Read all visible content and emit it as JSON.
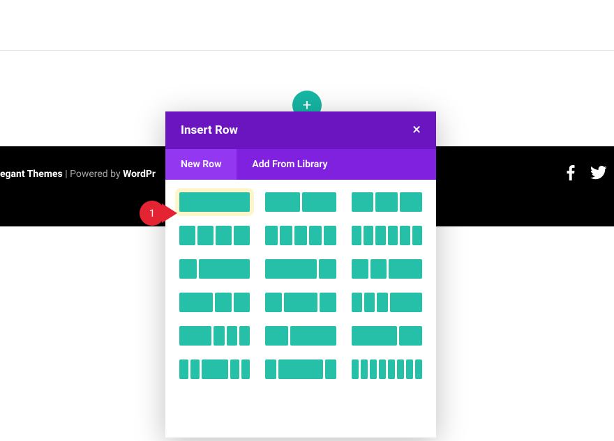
{
  "footer": {
    "brand": "egant Themes",
    "separator": " | ",
    "poweredBy": "Powered by ",
    "platform": "WordPr"
  },
  "addButton": {
    "label": "+"
  },
  "modal": {
    "title": "Insert Row",
    "close": "×",
    "tabs": [
      {
        "label": "New Row",
        "active": true
      },
      {
        "label": "Add From Library",
        "active": false
      }
    ]
  },
  "callout": {
    "number": "1"
  },
  "layouts": [
    {
      "cols": [
        1
      ],
      "selected": true
    },
    {
      "cols": [
        1,
        1
      ]
    },
    {
      "cols": [
        1,
        1,
        1
      ]
    },
    {
      "cols": [
        1,
        1,
        1,
        1
      ]
    },
    {
      "cols": [
        1,
        1,
        1,
        1,
        1
      ]
    },
    {
      "cols": [
        1,
        1,
        1,
        1,
        1,
        1
      ]
    },
    {
      "cols": [
        1,
        3
      ]
    },
    {
      "cols": [
        3,
        1
      ]
    },
    {
      "cols": [
        1,
        1,
        2
      ]
    },
    {
      "cols": [
        2,
        1,
        1
      ]
    },
    {
      "cols": [
        1,
        2,
        1
      ]
    },
    {
      "cols": [
        1,
        1,
        1,
        3
      ]
    },
    {
      "cols": [
        3,
        1,
        1,
        1
      ]
    },
    {
      "cols": [
        1,
        2
      ]
    },
    {
      "cols": [
        2,
        1
      ]
    },
    {
      "cols": [
        1,
        1,
        3,
        1,
        1
      ]
    },
    {
      "cols": [
        1,
        4,
        1
      ]
    },
    {
      "cols": [
        1,
        1,
        1,
        1,
        1,
        1,
        1,
        1
      ]
    }
  ]
}
